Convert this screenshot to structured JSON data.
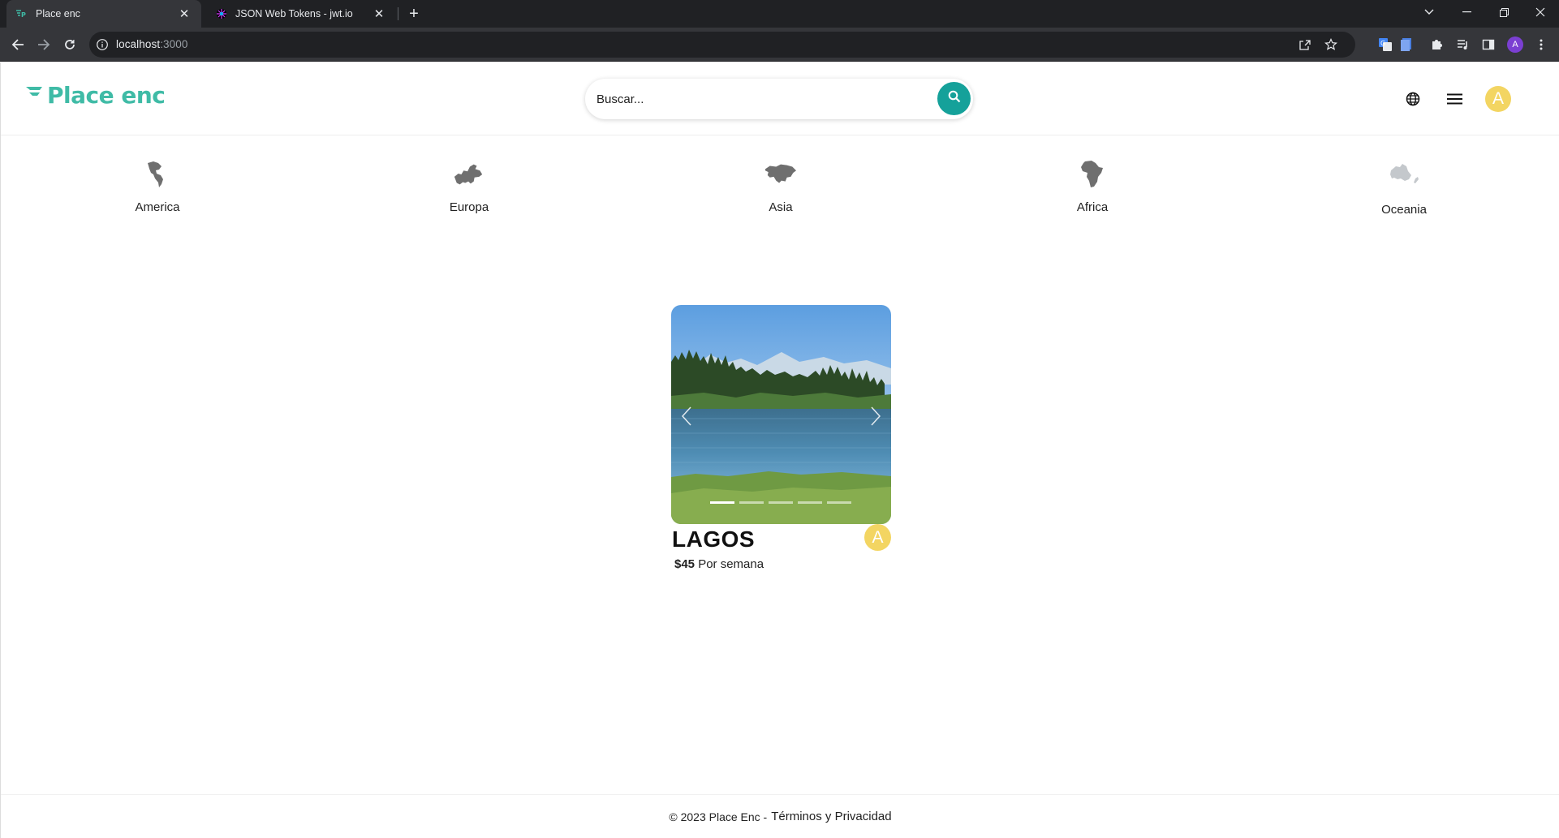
{
  "browser": {
    "tabs": [
      {
        "title": "Place enc",
        "active": true
      },
      {
        "title": "JSON Web Tokens - jwt.io",
        "active": false
      }
    ],
    "url_host": "localhost",
    "url_port": ":3000",
    "profile_initial": "A"
  },
  "header": {
    "logo_text": "Place enc",
    "search_placeholder": "Buscar...",
    "avatar_initial": "A"
  },
  "categories": [
    {
      "label": "America",
      "icon": "america-map-icon"
    },
    {
      "label": "Europa",
      "icon": "europe-map-icon"
    },
    {
      "label": "Asia",
      "icon": "asia-map-icon"
    },
    {
      "label": "Africa",
      "icon": "africa-map-icon"
    },
    {
      "label": "Oceania",
      "icon": "oceania-map-icon"
    }
  ],
  "listing": {
    "title": "LAGOS",
    "price": "$45",
    "price_suffix": "Por semana",
    "owner_initial": "A",
    "slide_count": 5,
    "active_slide": 1
  },
  "footer": {
    "copyright": "© 2023 Place Enc -",
    "terms": "Términos y Privacidad"
  },
  "colors": {
    "brand": "#3fbba6",
    "search_button": "#15a19a",
    "avatar": "#f3d562"
  }
}
